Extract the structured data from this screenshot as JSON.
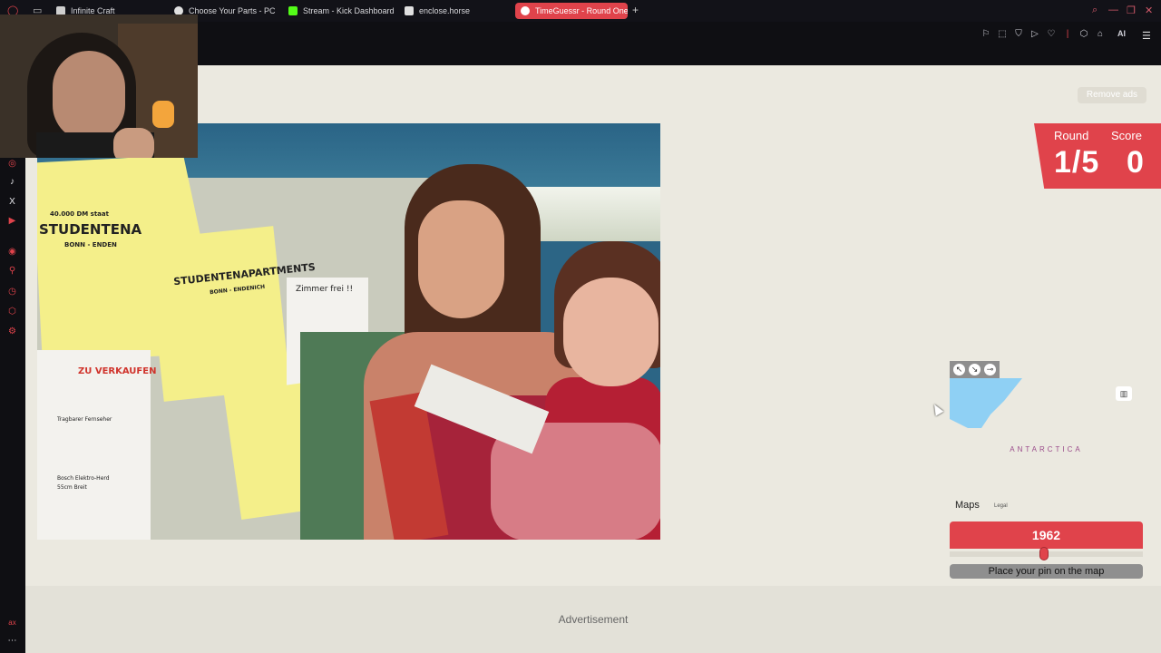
{
  "browser": {
    "tabs": [
      {
        "label": "Infinite Craft",
        "icon": "infinite-craft-icon",
        "color": "#cfcfcf"
      },
      {
        "label": "Choose Your Parts - PCPa",
        "icon": "pcpartpicker-icon",
        "color": "#e0e0e0"
      },
      {
        "label": "Stream - Kick Dashboard",
        "icon": "kick-icon",
        "color": "#53fc18"
      },
      {
        "label": "enclose.horse",
        "icon": "horse-icon",
        "color": "#e0e0e0"
      },
      {
        "label": "TimeGuessr - Round One",
        "icon": "timeguessr-icon",
        "color": "#ffffff",
        "active": true
      }
    ],
    "new_tab": "+",
    "toolbar_ai_label": "AI"
  },
  "page": {
    "remove_ads": "Remove ads",
    "round_label": "Round",
    "score_label": "Score",
    "round_value": "1/5",
    "score_value": "0",
    "accent_color": "#e0434b",
    "map": {
      "region_label": "ANTARCTICA",
      "brand": "Maps",
      "legal": "Legal"
    },
    "year": "1962",
    "year_slider_fraction": 0.49,
    "place_pin": "Place your pin on the map",
    "advertisement": "Advertisement"
  },
  "photo": {
    "poster_texts": [
      "40.000 DM staat",
      "STUDENTENA",
      "BONN - ENDEN",
      "STUDENTENAPARTMENTS",
      "BONN - ENDENICH",
      "Zimmer frei !!",
      "ZU VERKAUFEN",
      "Tragbarer Fernseher",
      "Bosch Elektro-Herd",
      "55cm Breit"
    ]
  }
}
